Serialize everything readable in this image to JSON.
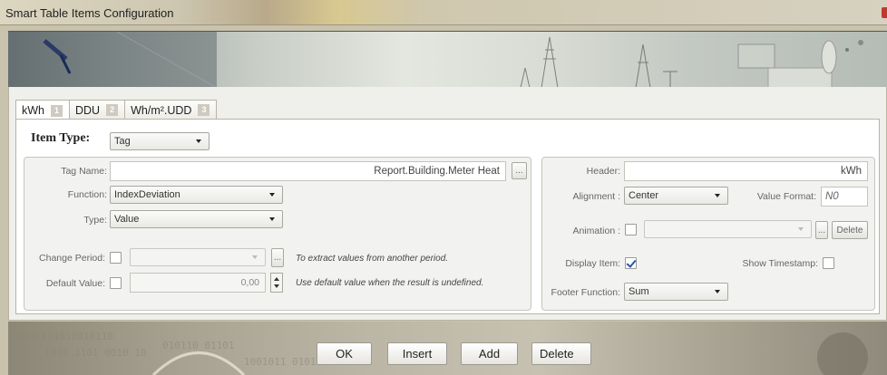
{
  "window": {
    "title": "Smart Table Items Configuration"
  },
  "tabs": [
    {
      "label": "kWh",
      "badge": "1"
    },
    {
      "label": "DDU",
      "badge": "2"
    },
    {
      "label": "Wh/m².UDD",
      "badge": "3"
    }
  ],
  "item_type": {
    "label": "Item Type:",
    "value": "Tag"
  },
  "left_group": {
    "tag_name": {
      "label": "Tag Name:",
      "value": "Report.Building.Meter Heat",
      "browse": "..."
    },
    "function": {
      "label": "Function:",
      "value": "IndexDeviation"
    },
    "type": {
      "label": "Type:",
      "value": "Value"
    },
    "change_period": {
      "label": "Change Period:",
      "browse": "...",
      "hint": "To extract values from another period."
    },
    "default_value": {
      "label": "Default Value:",
      "value": "0,00",
      "hint": "Use default value when the result is undefined."
    }
  },
  "right_group": {
    "header": {
      "label": "Header:",
      "value": "kWh"
    },
    "alignment": {
      "label": "Alignment :",
      "value": "Center"
    },
    "value_format": {
      "label": "Value Format:",
      "value": "N0"
    },
    "animation": {
      "label": "Animation :",
      "browse": "...",
      "delete": "Delete"
    },
    "display_item": {
      "label": "Display Item:",
      "checked": true
    },
    "show_timestamp": {
      "label": "Show Timestamp:",
      "checked": false
    },
    "footer_function": {
      "label": "Footer Function:",
      "value": "Sum"
    }
  },
  "footer": {
    "ok": "OK",
    "insert": "Insert",
    "add": "Add",
    "delete": "Delete"
  },
  "colors": {
    "accent_check": "#2b55a8",
    "close": "#c0392b"
  }
}
